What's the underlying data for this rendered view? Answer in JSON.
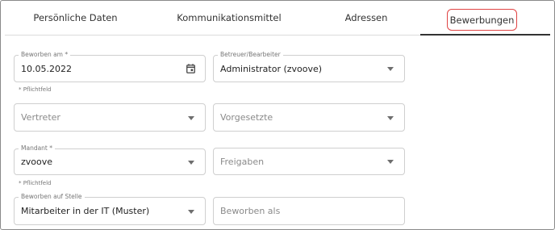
{
  "tabs": [
    {
      "label": "Persönliche Daten"
    },
    {
      "label": "Kommunikationsmittel"
    },
    {
      "label": "Adressen"
    },
    {
      "label": "Bewerbungen"
    }
  ],
  "form": {
    "beworben_am": {
      "label": "Beworben am *",
      "value": "10.05.2022",
      "hint": "* Pflichtfeld"
    },
    "betreuer": {
      "label": "Betreuer/Bearbeiter",
      "value": "Administrator (zvoove)"
    },
    "vertreter": {
      "placeholder": "Vertreter"
    },
    "vorgesetzte": {
      "placeholder": "Vorgesetzte"
    },
    "mandant": {
      "label": "Mandant *",
      "value": "zvoove",
      "hint": "* Pflichtfeld"
    },
    "freigaben": {
      "placeholder": "Freigaben"
    },
    "beworben_stelle": {
      "label": "Beworben auf Stelle",
      "value": "Mitarbeiter in der IT (Muster)"
    },
    "beworben_als": {
      "placeholder": "Beworben als"
    }
  },
  "colors": {
    "highlight": "#e04444",
    "active_underline": "#333333",
    "border": "#cfcfcf"
  },
  "icons": [
    "calendar-icon",
    "chevron-down-icon"
  ]
}
